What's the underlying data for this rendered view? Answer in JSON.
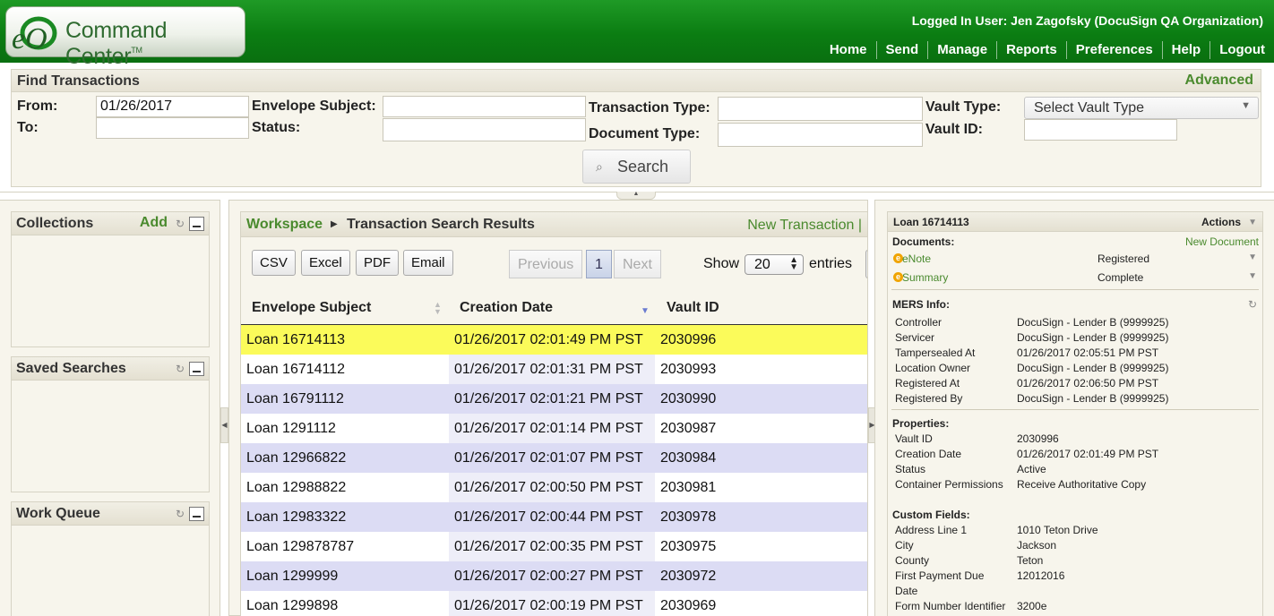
{
  "header": {
    "logo_text": "Command Center",
    "logo_tm": "TM",
    "logo_mark": "eO",
    "logged_in": "Logged In User: Jen Zagofsky (DocuSign QA Organization)",
    "nav": [
      "Home",
      "Send",
      "Manage",
      "Reports",
      "Preferences",
      "Help",
      "Logout"
    ]
  },
  "find": {
    "title": "Find Transactions",
    "advanced": "Advanced",
    "from_label": "From:",
    "from_value": "01/26/2017",
    "to_label": "To:",
    "to_value": "",
    "envelope_subject_label": "Envelope Subject:",
    "envelope_subject_value": "",
    "status_label": "Status:",
    "status_value": "",
    "transaction_type_label": "Transaction Type:",
    "transaction_type_value": "",
    "document_type_label": "Document Type:",
    "document_type_value": "",
    "vault_type_label": "Vault Type:",
    "vault_type_value": "Select Vault Type",
    "vault_id_label": "Vault ID:",
    "vault_id_value": "",
    "search_label": "Search",
    "search_icon": "magnifier-icon"
  },
  "sidebar": {
    "collections": {
      "title": "Collections",
      "add": "Add"
    },
    "saved_searches": {
      "title": "Saved Searches"
    },
    "work_queue": {
      "title": "Work Queue"
    }
  },
  "workspace": {
    "crumb_root": "Workspace",
    "crumb_current": "Transaction Search Results",
    "new_transaction": "New Transaction |",
    "export_buttons": [
      "CSV",
      "Excel",
      "PDF",
      "Email"
    ],
    "pager": {
      "previous": "Previous",
      "page": "1",
      "next": "Next"
    },
    "show_label": "Show",
    "show_value": "20",
    "entries_label": "entries",
    "columns": [
      "Envelope Subject",
      "Creation Date",
      "Vault ID"
    ],
    "rows": [
      {
        "subject": "Loan 16714113",
        "date": "01/26/2017 02:01:49 PM PST",
        "vault": "2030996"
      },
      {
        "subject": "Loan 16714112",
        "date": "01/26/2017 02:01:31 PM PST",
        "vault": "2030993"
      },
      {
        "subject": "Loan 16791112",
        "date": "01/26/2017 02:01:21 PM PST",
        "vault": "2030990"
      },
      {
        "subject": "Loan 1291112",
        "date": "01/26/2017 02:01:14 PM PST",
        "vault": "2030987"
      },
      {
        "subject": "Loan 12966822",
        "date": "01/26/2017 02:01:07 PM PST",
        "vault": "2030984"
      },
      {
        "subject": "Loan 12988822",
        "date": "01/26/2017 02:00:50 PM PST",
        "vault": "2030981"
      },
      {
        "subject": "Loan 12983322",
        "date": "01/26/2017 02:00:44 PM PST",
        "vault": "2030978"
      },
      {
        "subject": "Loan 129878787",
        "date": "01/26/2017 02:00:35 PM PST",
        "vault": "2030975"
      },
      {
        "subject": "Loan 1299999",
        "date": "01/26/2017 02:00:27 PM PST",
        "vault": "2030972"
      },
      {
        "subject": "Loan 1299898",
        "date": "01/26/2017 02:00:19 PM PST",
        "vault": "2030969"
      }
    ],
    "selected_row_color": "#fbfb5a"
  },
  "details": {
    "title": "Loan 16714113",
    "actions": "Actions",
    "documents_label": "Documents:",
    "new_document": "New Document",
    "documents": [
      {
        "name": "eNote",
        "status": "Registered"
      },
      {
        "name": "Summary",
        "status": "Complete"
      }
    ],
    "mers_label": "MERS Info:",
    "mers": [
      {
        "k": "Controller",
        "v": "DocuSign - Lender B (9999925)"
      },
      {
        "k": "Servicer",
        "v": "DocuSign - Lender B (9999925)"
      },
      {
        "k": "Tampersealed At",
        "v": "01/26/2017 02:05:51 PM PST"
      },
      {
        "k": "Location Owner",
        "v": "DocuSign - Lender B (9999925)"
      },
      {
        "k": "Registered At",
        "v": "01/26/2017 02:06:50 PM PST"
      },
      {
        "k": "Registered By",
        "v": "DocuSign - Lender B (9999925)"
      }
    ],
    "properties_label": "Properties:",
    "properties": [
      {
        "k": "Vault ID",
        "v": "2030996"
      },
      {
        "k": "Creation Date",
        "v": "01/26/2017 02:01:49 PM PST"
      },
      {
        "k": "Status",
        "v": "Active"
      },
      {
        "k": "Container Permissions",
        "v": "Receive Authoritative Copy"
      }
    ],
    "custom_label": "Custom Fields:",
    "custom": [
      {
        "k": "Address Line 1",
        "v": "1010 Teton Drive"
      },
      {
        "k": "City",
        "v": "Jackson"
      },
      {
        "k": "County",
        "v": "Teton"
      },
      {
        "k": "First Payment Due",
        "v": "12012016"
      },
      {
        "k": "Date",
        "v": ""
      },
      {
        "k": "Form Number Identifier",
        "v": "3200e"
      }
    ]
  },
  "colors": {
    "brand_green": "#0b7d12",
    "link_green": "#4a8a2e",
    "panel_bg": "#f7f5ec",
    "row_alt": "#dcdcf4"
  }
}
